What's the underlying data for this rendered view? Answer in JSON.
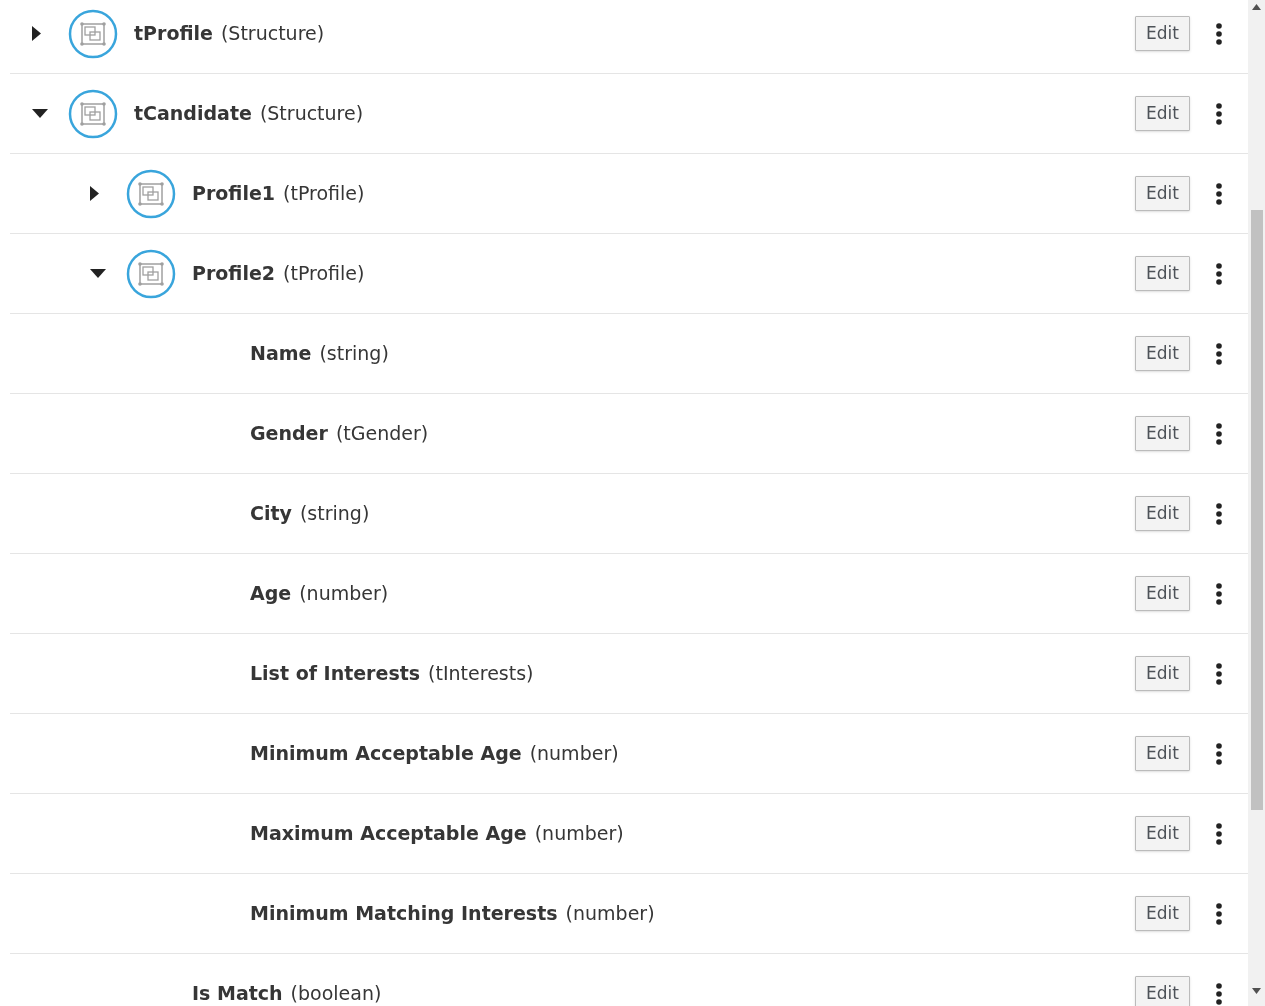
{
  "tree": [
    {
      "kind": "structure",
      "name": "tProfile",
      "type": "(Structure)",
      "expanded": false,
      "button": "Edit"
    },
    {
      "kind": "structure",
      "name": "tCandidate",
      "type": "(Structure)",
      "expanded": true,
      "button": "Edit",
      "children": [
        {
          "kind": "structure",
          "name": "Profile1",
          "type": "(tProfile)",
          "expanded": false,
          "button": "Edit"
        },
        {
          "kind": "structure",
          "name": "Profile2",
          "type": "(tProfile)",
          "expanded": true,
          "button": "Edit",
          "children": [
            {
              "kind": "field",
              "name": "Name",
              "type": "(string)",
              "button": "Edit"
            },
            {
              "kind": "field",
              "name": "Gender",
              "type": "(tGender)",
              "button": "Edit"
            },
            {
              "kind": "field",
              "name": "City",
              "type": "(string)",
              "button": "Edit"
            },
            {
              "kind": "field",
              "name": "Age",
              "type": "(number)",
              "button": "Edit"
            },
            {
              "kind": "field",
              "name": "List of Interests",
              "type": "(tInterests)",
              "button": "Edit"
            },
            {
              "kind": "field",
              "name": "Minimum Acceptable Age",
              "type": "(number)",
              "button": "Edit"
            },
            {
              "kind": "field",
              "name": "Maximum Acceptable Age",
              "type": "(number)",
              "button": "Edit"
            },
            {
              "kind": "field",
              "name": "Minimum Matching Interests",
              "type": "(number)",
              "button": "Edit"
            }
          ]
        },
        {
          "kind": "field",
          "name": "Is Match",
          "type": "(boolean)",
          "button": "Edit"
        }
      ]
    }
  ]
}
